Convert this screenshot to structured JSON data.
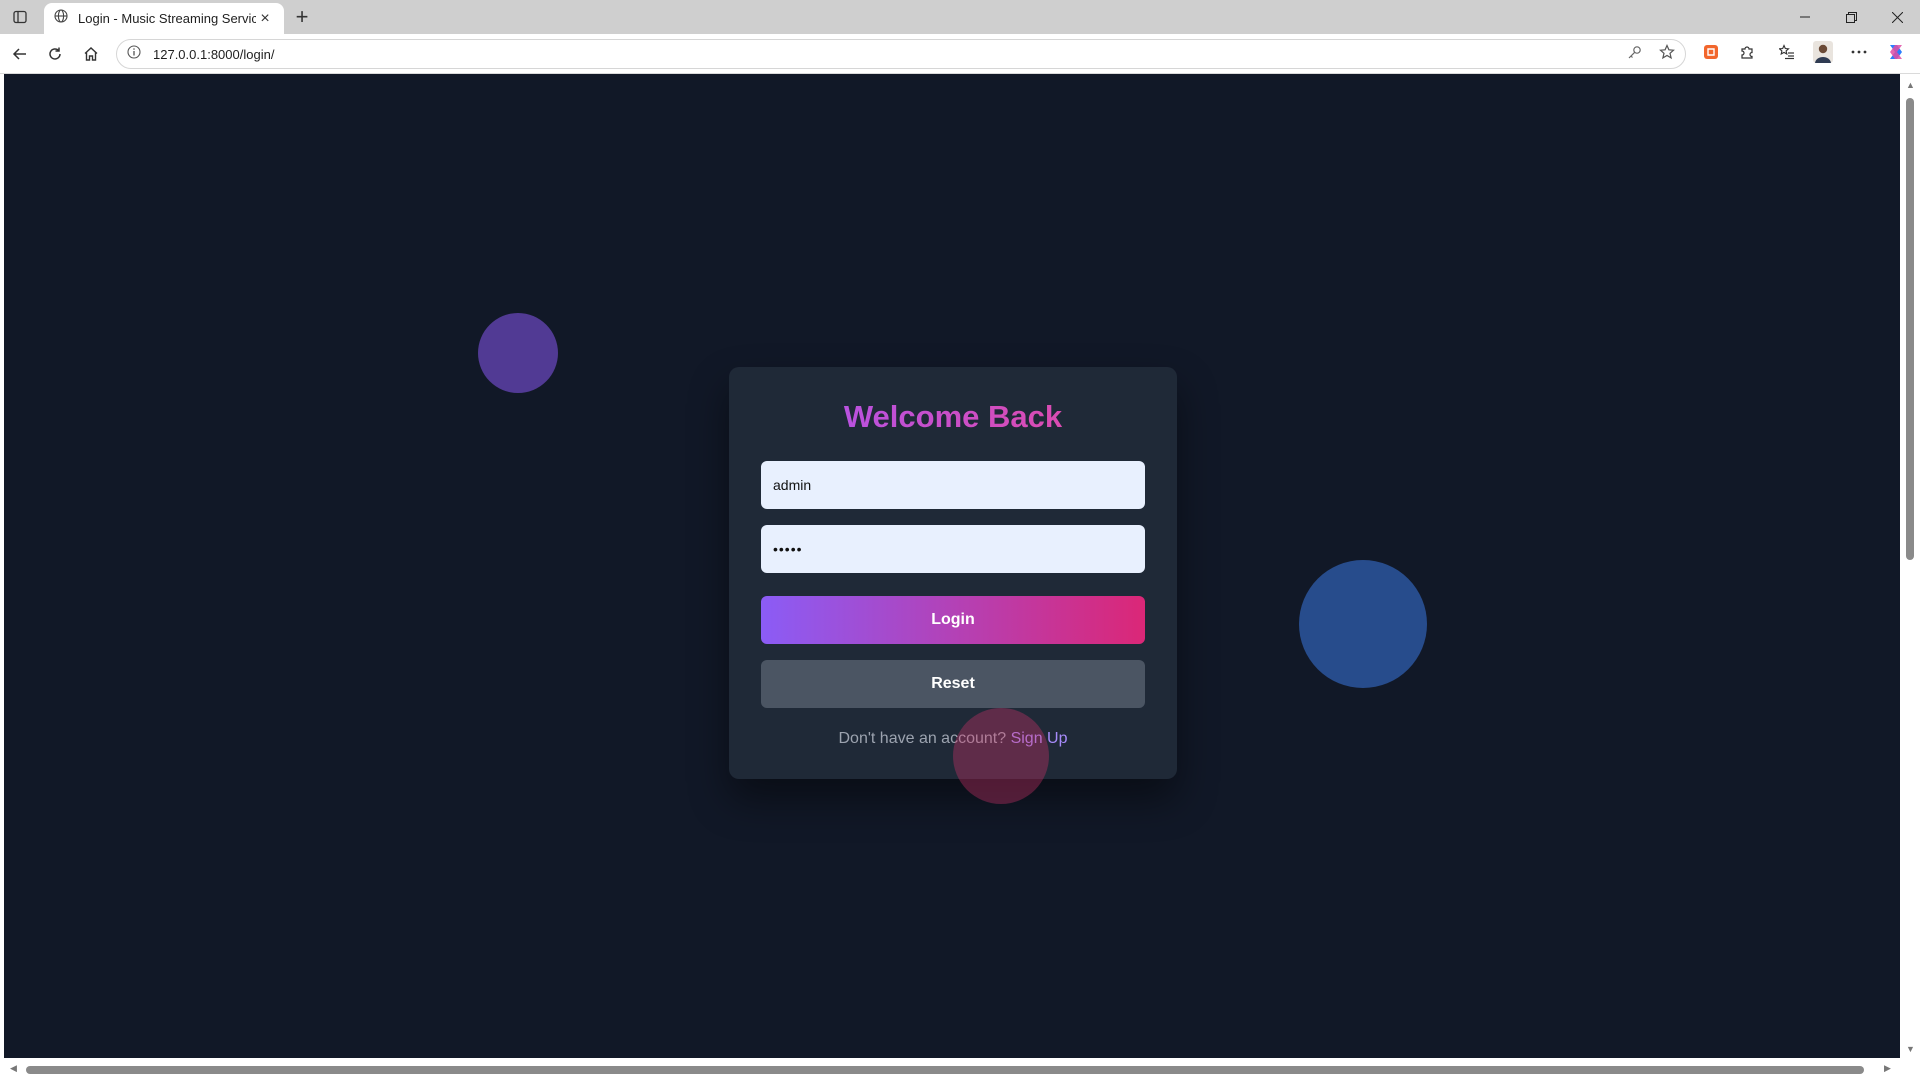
{
  "browser": {
    "tab_title": "Login - Music Streaming Services",
    "url": "127.0.0.1:8000/login/",
    "new_tab_symbol": "+",
    "close_symbol": "×"
  },
  "icons": {
    "tab_actions": "tab-actions-icon",
    "site_info": "info-icon",
    "back": "back-arrow-icon",
    "reload": "reload-icon",
    "home": "home-icon",
    "password_key": "key-icon",
    "favorite": "star-icon",
    "extensions": "puzzle-icon",
    "collections": "favorites-list-icon",
    "profile": "avatar-icon",
    "more": "more-icon",
    "copilot": "copilot-icon"
  },
  "login": {
    "title": "Welcome Back",
    "username_value": "admin",
    "password_value": "•••••",
    "login_label": "Login",
    "reset_label": "Reset",
    "signup_prompt": "Don't have an account?",
    "signup_link": "Sign Up"
  },
  "colors": {
    "page_background": "#111827",
    "card_background": "#1f2937",
    "accent_start": "#8b5cf6",
    "accent_end": "#db2777",
    "reset_button": "#4b5563",
    "link": "#a78bfa"
  }
}
